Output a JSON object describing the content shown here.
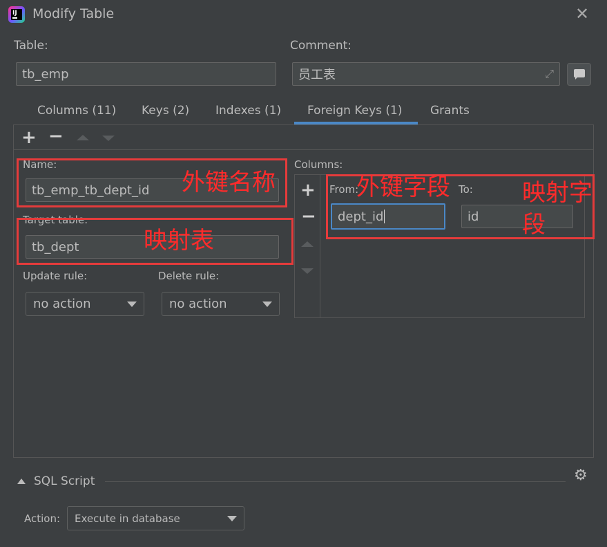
{
  "window": {
    "title": "Modify Table"
  },
  "table": {
    "label": "Table:",
    "value": "tb_emp"
  },
  "comment": {
    "label": "Comment:",
    "value": "员工表"
  },
  "tabs": [
    {
      "label": "Columns (11)"
    },
    {
      "label": "Keys (2)"
    },
    {
      "label": "Indexes (1)"
    },
    {
      "label": "Foreign Keys (1)"
    },
    {
      "label": "Grants"
    }
  ],
  "foreign_key": {
    "name_label": "Name:",
    "name_value": "tb_emp_tb_dept_id",
    "target_label": "Target table:",
    "target_value": "tb_dept",
    "update_label": "Update rule:",
    "update_value": "no action",
    "delete_label": "Delete rule:",
    "delete_value": "no action",
    "columns_label": "Columns:",
    "from_label": "From:",
    "to_label": "To:",
    "from_value": "dept_id",
    "to_value": "id"
  },
  "annotations": {
    "name": "外键名称",
    "target": "映射表",
    "from": "外键字段",
    "to_line1": "映射字",
    "to_line2": "段"
  },
  "sql": {
    "label": "SQL Script"
  },
  "action": {
    "label": "Action:",
    "value": "Execute in database"
  },
  "colors": {
    "accent": "#4a88c7",
    "annotation": "#e53b3b",
    "background": "#3c3f41"
  }
}
